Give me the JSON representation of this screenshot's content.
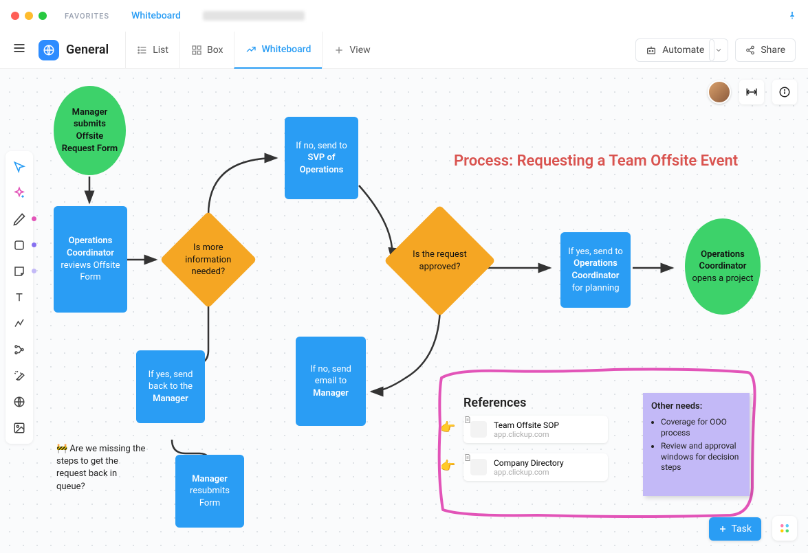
{
  "window": {
    "favorites_label": "FAVORITES",
    "breadcrumb_current": "Whiteboard"
  },
  "toolbar": {
    "space_name": "General",
    "views": {
      "list": "List",
      "box": "Box",
      "whiteboard": "Whiteboard",
      "add": "View"
    },
    "automate": "Automate",
    "share": "Share"
  },
  "canvas": {
    "title": "Process: Requesting a Team Offsite Event",
    "nodes": {
      "start": {
        "line1": "Manager submits Offsite Request Form"
      },
      "review": {
        "bold": "Operations Coordinator",
        "rest": " reviews Offsite Form"
      },
      "decision1": "Is more information needed?",
      "svp": {
        "pre": "If no, send to ",
        "bold": "SVP of Operations"
      },
      "send_back": {
        "pre": "If yes, send back to the ",
        "bold": "Manager"
      },
      "resubmit": {
        "bold": "Manager",
        "rest": " resubmits Form"
      },
      "decision2": "Is the request approved?",
      "email_no": {
        "pre": "If no, send email to ",
        "bold": "Manager"
      },
      "planning": {
        "pre": "If yes, send to ",
        "bold": "Operations Coordinator",
        "rest": " for planning"
      },
      "end": {
        "bold": "Operations Coordinator",
        "rest": " opens a project"
      }
    },
    "comment": "🚧 Are we missing the steps to get the request back in queue?",
    "references": {
      "title": "References",
      "items": [
        {
          "title": "Team Offsite SOP",
          "subtitle": "app.clickup.com"
        },
        {
          "title": "Company Directory",
          "subtitle": "app.clickup.com"
        }
      ],
      "hand_icon": "👉"
    },
    "sticky": {
      "title": "Other needs:",
      "items": [
        "Coverage for OOO process",
        "Review and approval windows for decision steps"
      ]
    }
  },
  "footer": {
    "task_button": "Task"
  }
}
